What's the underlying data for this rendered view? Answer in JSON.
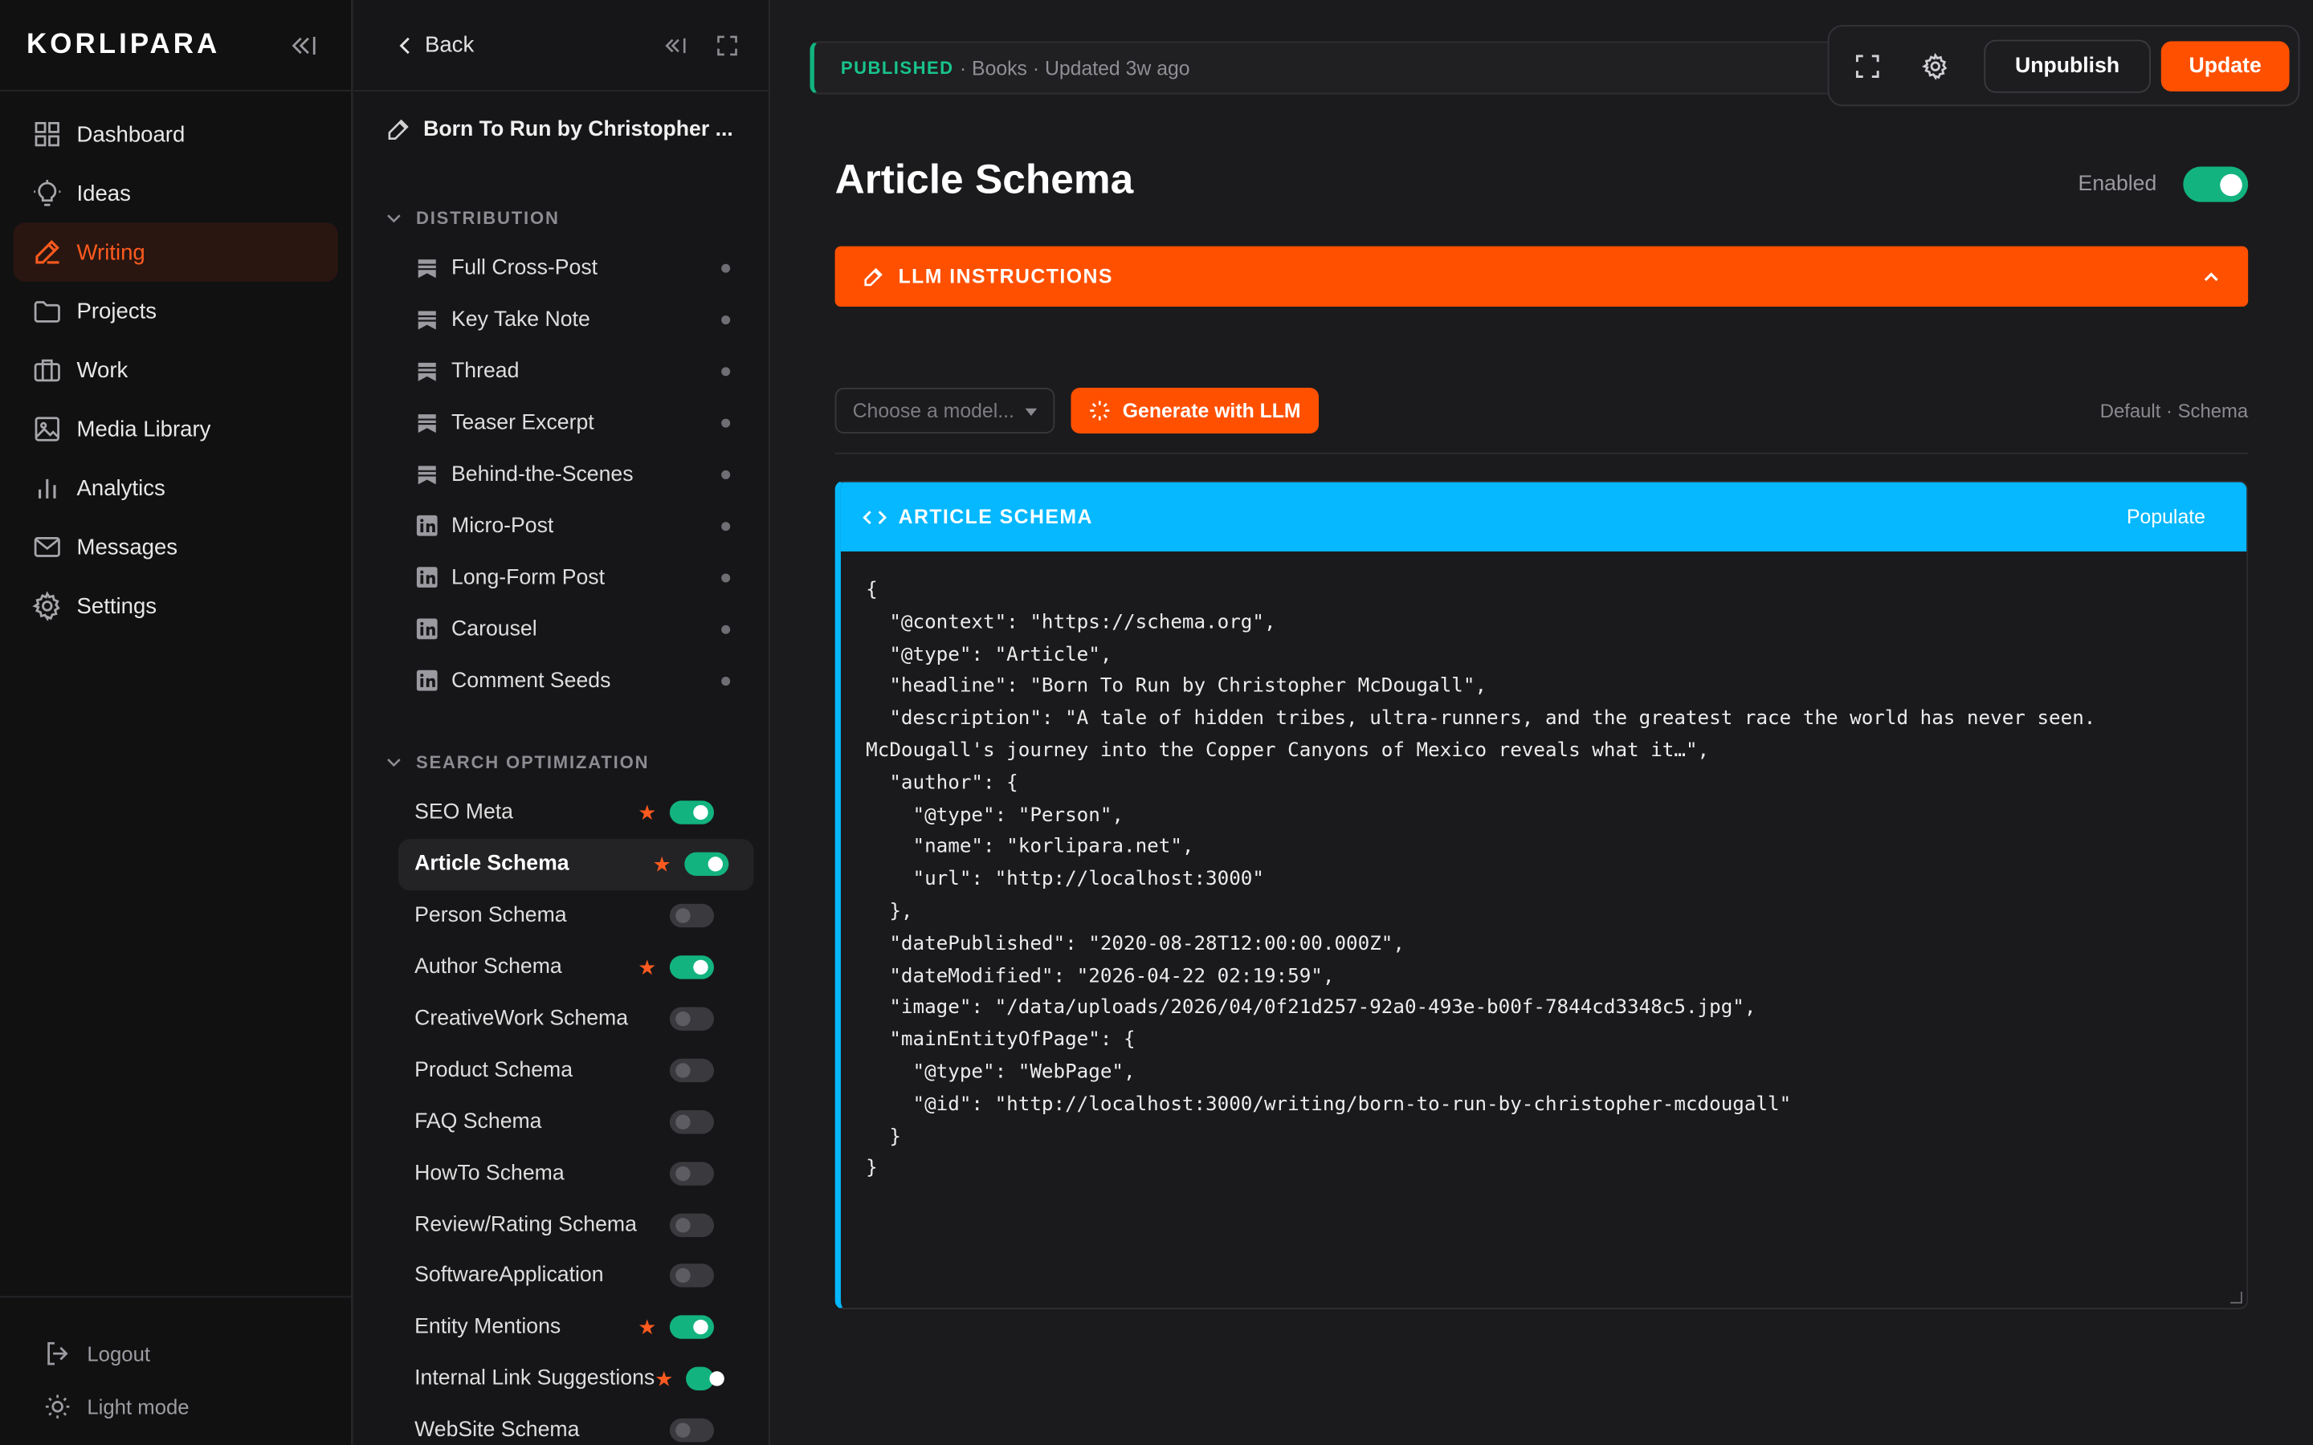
{
  "app": {
    "logo": "KORLIPARA",
    "nav": [
      {
        "label": "Dashboard",
        "icon": "grid-icon",
        "active": false
      },
      {
        "label": "Ideas",
        "icon": "lightbulb-icon",
        "active": false
      },
      {
        "label": "Writing",
        "icon": "pen-icon",
        "active": true
      },
      {
        "label": "Projects",
        "icon": "folder-icon",
        "active": false
      },
      {
        "label": "Work",
        "icon": "briefcase-icon",
        "active": false
      },
      {
        "label": "Media Library",
        "icon": "image-icon",
        "active": false
      },
      {
        "label": "Analytics",
        "icon": "bar-chart-icon",
        "active": false
      },
      {
        "label": "Messages",
        "icon": "mail-icon",
        "active": false
      },
      {
        "label": "Settings",
        "icon": "gear-icon",
        "active": false
      }
    ],
    "logout": "Logout",
    "light_mode": "Light mode"
  },
  "panel": {
    "back": "Back",
    "doc_title": "Born To Run by Christopher ...",
    "distribution_header": "DISTRIBUTION",
    "distribution": [
      {
        "label": "Full Cross-Post",
        "icon": "bookmark-icon"
      },
      {
        "label": "Key Take Note",
        "icon": "bookmark-icon"
      },
      {
        "label": "Thread",
        "icon": "bookmark-icon"
      },
      {
        "label": "Teaser Excerpt",
        "icon": "bookmark-icon"
      },
      {
        "label": "Behind-the-Scenes",
        "icon": "bookmark-icon"
      },
      {
        "label": "Micro-Post",
        "icon": "linkedin-icon"
      },
      {
        "label": "Long-Form Post",
        "icon": "linkedin-icon"
      },
      {
        "label": "Carousel",
        "icon": "linkedin-icon"
      },
      {
        "label": "Comment Seeds",
        "icon": "linkedin-icon"
      }
    ],
    "search_header": "SEARCH OPTIMIZATION",
    "search": [
      {
        "label": "SEO Meta",
        "starred": true,
        "enabled": true,
        "active": false
      },
      {
        "label": "Article Schema",
        "starred": true,
        "enabled": true,
        "active": true
      },
      {
        "label": "Person Schema",
        "starred": false,
        "enabled": false,
        "active": false
      },
      {
        "label": "Author Schema",
        "starred": true,
        "enabled": true,
        "active": false
      },
      {
        "label": "CreativeWork Schema",
        "starred": false,
        "enabled": false,
        "active": false
      },
      {
        "label": "Product Schema",
        "starred": false,
        "enabled": false,
        "active": false
      },
      {
        "label": "FAQ Schema",
        "starred": false,
        "enabled": false,
        "active": false
      },
      {
        "label": "HowTo Schema",
        "starred": false,
        "enabled": false,
        "active": false
      },
      {
        "label": "Review/Rating Schema",
        "starred": false,
        "enabled": false,
        "active": false
      },
      {
        "label": "SoftwareApplication",
        "starred": false,
        "enabled": false,
        "active": false
      },
      {
        "label": "Entity Mentions",
        "starred": true,
        "enabled": true,
        "active": false
      },
      {
        "label": "Internal Link Suggestions",
        "starred": true,
        "enabled": true,
        "active": false
      },
      {
        "label": "WebSite Schema",
        "starred": false,
        "enabled": false,
        "active": false
      }
    ]
  },
  "main": {
    "status_label": "PUBLISHED",
    "status_meta": "· Books · Updated 3w ago",
    "unpublish": "Unpublish",
    "update": "Update",
    "title": "Article Schema",
    "enabled_label": "Enabled",
    "enabled": true,
    "llm_bar": "LLM INSTRUCTIONS",
    "model_placeholder": "Choose a model...",
    "generate": "Generate with LLM",
    "default_schema": "Default · Schema",
    "schema_header": "ARTICLE SCHEMA",
    "populate": "Populate",
    "code": "{\n  \"@context\": \"https://schema.org\",\n  \"@type\": \"Article\",\n  \"headline\": \"Born To Run by Christopher McDougall\",\n  \"description\": \"A tale of hidden tribes, ultra-runners, and the greatest race the world has never seen.\nMcDougall's journey into the Copper Canyons of Mexico reveals what it…\",\n  \"author\": {\n    \"@type\": \"Person\",\n    \"name\": \"korlipara.net\",\n    \"url\": \"http://localhost:3000\"\n  },\n  \"datePublished\": \"2020-08-28T12:00:00.000Z\",\n  \"dateModified\": \"2026-04-22 02:19:59\",\n  \"image\": \"/data/uploads/2026/04/0f21d257-92a0-493e-b00f-7844cd3348c5.jpg\",\n  \"mainEntityOfPage\": {\n    \"@type\": \"WebPage\",\n    \"@id\": \"http://localhost:3000/writing/born-to-run-by-christopher-mcdougall\"\n  }\n}"
  },
  "colors": {
    "accent": "#ff5000",
    "success": "#12b37f",
    "schema_blue": "#05b8ff"
  }
}
